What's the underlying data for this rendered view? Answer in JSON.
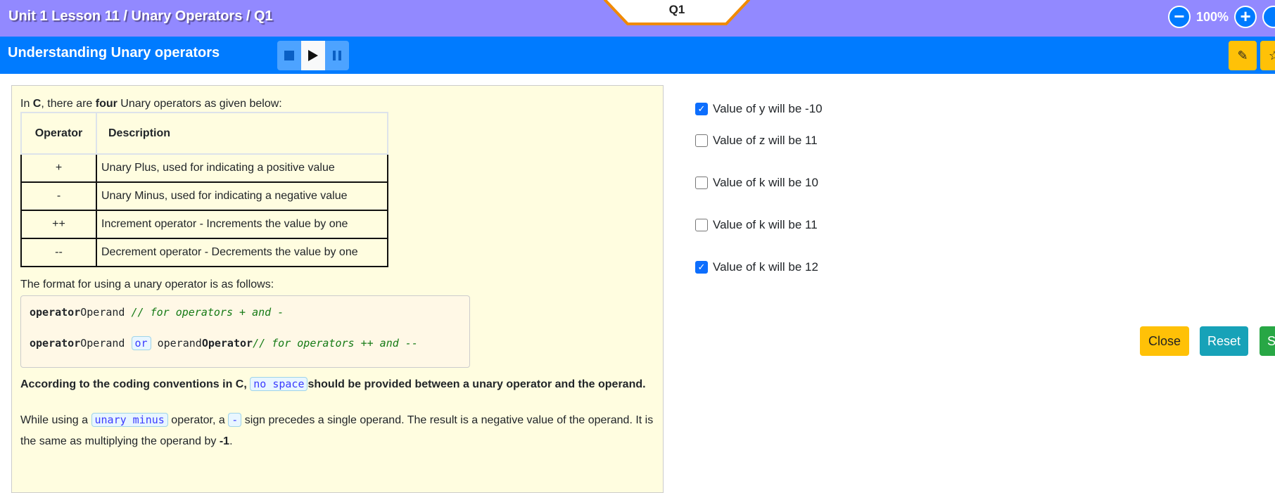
{
  "header": {
    "breadcrumb": "Unit 1 Lesson 11 / Unary Operators / Q1",
    "question_tab": "Q1",
    "zoom_level": "100%",
    "zoom_out_icon": "minus-circle-icon",
    "zoom_in_icon": "plus-circle-icon"
  },
  "subheader": {
    "title": "Understanding Unary operators",
    "media": [
      "stop-icon",
      "play-icon",
      "pause-icon"
    ],
    "edit_icon": "pencil-icon",
    "star_icon": "star-icon"
  },
  "content": {
    "intro": {
      "a": "In ",
      "b": "C",
      "c": ", there are ",
      "d": "four",
      "e": " Unary operators as given below:"
    },
    "table": {
      "headers": [
        "Operator",
        "Description"
      ],
      "rows": [
        [
          "+",
          "Unary Plus, used for indicating a positive value"
        ],
        [
          "-",
          "Unary Minus, used for indicating a negative value"
        ],
        [
          "++",
          "Increment operator - Increments the value by one"
        ],
        [
          "--",
          "Decrement operator - Decrements the value by one"
        ]
      ]
    },
    "format_intro": "The format for using a unary operator is as follows:",
    "code": {
      "l1_kw": "operator",
      "l1_rest": "Operand ",
      "l1_comment": "// for  operators + and -",
      "l2_kw": "operator",
      "l2_rest": "Operand ",
      "l2_or": "or",
      "l2_op": " operand",
      "l2_kw2": "Operator",
      "l2_comment": "// for  operators ++ and --"
    },
    "convention": {
      "a": "According to the coding conventions in C, ",
      "tag": "no space",
      "b": "should be provided between a unary operator and the operand."
    },
    "minus": {
      "a": "While using a ",
      "tag1": "unary minus",
      "b": " operator, a ",
      "tag2": "-",
      "c": " sign precedes a single operand. The result is a negative value of the operand. It is the same as multiplying the operand by ",
      "d": "-1",
      "e": "."
    }
  },
  "options": [
    {
      "label": "Value of y will be -10",
      "checked": true
    },
    {
      "label": "Value of z will be 11",
      "checked": false
    },
    {
      "label": "Value of k will be 10",
      "checked": false
    },
    {
      "label": "Value of k will be 11",
      "checked": false
    },
    {
      "label": "Value of k will be 12",
      "checked": true
    }
  ],
  "buttons": {
    "close": "Close",
    "reset": "Reset",
    "submit_partial": "S"
  },
  "colors": {
    "topbar": "#9289ff",
    "bluebar": "#007bff",
    "panel": "#fffde0",
    "close": "#ffc107",
    "reset": "#17a2b8",
    "submit": "#28a745"
  }
}
